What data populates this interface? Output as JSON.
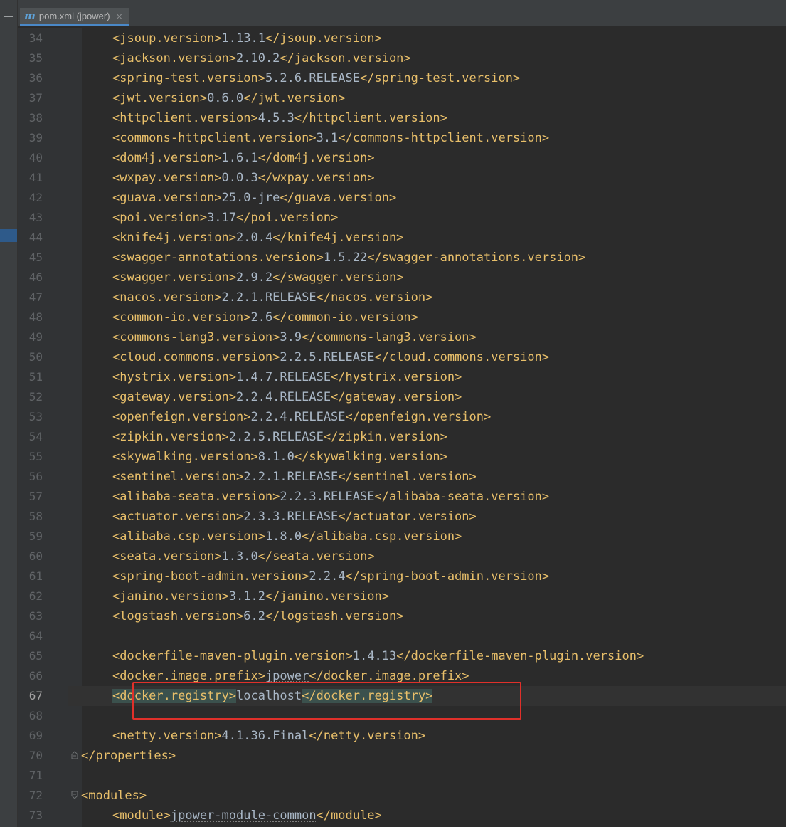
{
  "tab": {
    "icon": "maven-icon",
    "label": "pom.xml (jpower)",
    "close": "×",
    "accent": "#4a88c7"
  },
  "colors": {
    "tag": "#e8bf6a",
    "text": "#a9b7c6",
    "line_number": "#606366",
    "highlight_box": "#e0302a"
  },
  "current_line": 67,
  "highlight_box_line": 67,
  "lines": [
    {
      "n": "34",
      "open": "<jsoup.version>",
      "value": "1.13.1",
      "close": "</jsoup.version>"
    },
    {
      "n": "35",
      "open": "<jackson.version>",
      "value": "2.10.2",
      "close": "</jackson.version>"
    },
    {
      "n": "36",
      "open": "<spring-test.version>",
      "value": "5.2.6.RELEASE",
      "close": "</spring-test.version>"
    },
    {
      "n": "37",
      "open": "<jwt.version>",
      "value": "0.6.0",
      "close": "</jwt.version>"
    },
    {
      "n": "38",
      "open": "<httpclient.version>",
      "value": "4.5.3",
      "close": "</httpclient.version>"
    },
    {
      "n": "39",
      "open": "<commons-httpclient.version>",
      "value": "3.1",
      "close": "</commons-httpclient.version>"
    },
    {
      "n": "40",
      "open": "<dom4j.version>",
      "value": "1.6.1",
      "close": "</dom4j.version>"
    },
    {
      "n": "41",
      "open": "<wxpay.version>",
      "value": "0.0.3",
      "close": "</wxpay.version>"
    },
    {
      "n": "42",
      "open": "<guava.version>",
      "value": "25.0-jre",
      "close": "</guava.version>"
    },
    {
      "n": "43",
      "open": "<poi.version>",
      "value": "3.17",
      "close": "</poi.version>"
    },
    {
      "n": "44",
      "open": "<knife4j.version>",
      "value": "2.0.4",
      "close": "</knife4j.version>"
    },
    {
      "n": "45",
      "open": "<swagger-annotations.version>",
      "value": "1.5.22",
      "close": "</swagger-annotations.version>"
    },
    {
      "n": "46",
      "open": "<swagger.version>",
      "value": "2.9.2",
      "close": "</swagger.version>"
    },
    {
      "n": "47",
      "open": "<nacos.version>",
      "value": "2.2.1.RELEASE",
      "close": "</nacos.version>"
    },
    {
      "n": "48",
      "open": "<common-io.version>",
      "value": "2.6",
      "close": "</common-io.version>"
    },
    {
      "n": "49",
      "open": "<commons-lang3.version>",
      "value": "3.9",
      "close": "</commons-lang3.version>"
    },
    {
      "n": "50",
      "open": "<cloud.commons.version>",
      "value": "2.2.5.RELEASE",
      "close": "</cloud.commons.version>"
    },
    {
      "n": "51",
      "open": "<hystrix.version>",
      "value": "1.4.7.RELEASE",
      "close": "</hystrix.version>"
    },
    {
      "n": "52",
      "open": "<gateway.version>",
      "value": "2.2.4.RELEASE",
      "close": "</gateway.version>"
    },
    {
      "n": "53",
      "open": "<openfeign.version>",
      "value": "2.2.4.RELEASE",
      "close": "</openfeign.version>"
    },
    {
      "n": "54",
      "open": "<zipkin.version>",
      "value": "2.2.5.RELEASE",
      "close": "</zipkin.version>"
    },
    {
      "n": "55",
      "open": "<skywalking.version>",
      "value": "8.1.0",
      "close": "</skywalking.version>"
    },
    {
      "n": "56",
      "open": "<sentinel.version>",
      "value": "2.2.1.RELEASE",
      "close": "</sentinel.version>"
    },
    {
      "n": "57",
      "open": "<alibaba-seata.version>",
      "value": "2.2.3.RELEASE",
      "close": "</alibaba-seata.version>"
    },
    {
      "n": "58",
      "open": "<actuator.version>",
      "value": "2.3.3.RELEASE",
      "close": "</actuator.version>"
    },
    {
      "n": "59",
      "open": "<alibaba.csp.version>",
      "value": "1.8.0",
      "close": "</alibaba.csp.version>"
    },
    {
      "n": "60",
      "open": "<seata.version>",
      "value": "1.3.0",
      "close": "</seata.version>"
    },
    {
      "n": "61",
      "open": "<spring-boot-admin.version>",
      "value": "2.2.4",
      "close": "</spring-boot-admin.version>"
    },
    {
      "n": "62",
      "open": "<janino.version>",
      "value": "3.1.2",
      "close": "</janino.version>"
    },
    {
      "n": "63",
      "open": "<logstash.version>",
      "value": "6.2",
      "close": "</logstash.version>"
    },
    {
      "n": "64",
      "open": "",
      "value": "",
      "close": ""
    },
    {
      "n": "65",
      "open": "<dockerfile-maven-plugin.version>",
      "value": "1.4.13",
      "close": "</dockerfile-maven-plugin.version>"
    },
    {
      "n": "66",
      "open": "<docker.image.prefix>",
      "value": "jpower",
      "close": "</docker.image.prefix>"
    },
    {
      "n": "67",
      "open": "<docker.registry>",
      "value": "localhost",
      "close": "</docker.registry>"
    },
    {
      "n": "68",
      "open": "",
      "value": "",
      "close": ""
    },
    {
      "n": "69",
      "open": "<netty.version>",
      "value": "4.1.36.Final",
      "close": "</netty.version>"
    },
    {
      "n": "70",
      "open": "</properties>",
      "value": "",
      "close": ""
    },
    {
      "n": "71",
      "open": "",
      "value": "",
      "close": ""
    },
    {
      "n": "72",
      "open": "<modules>",
      "value": "",
      "close": ""
    },
    {
      "n": "73",
      "open": "<module>",
      "value": "jpower-module-common",
      "close": "</module>"
    }
  ]
}
